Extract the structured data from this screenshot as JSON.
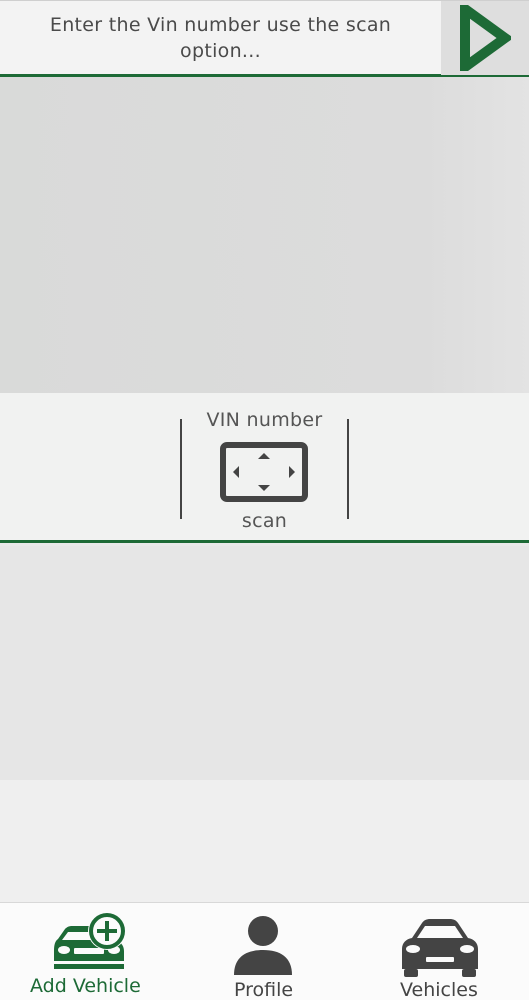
{
  "search": {
    "placeholder": "Enter the Vin number use the scan option..."
  },
  "scan": {
    "title": "VIN number",
    "label": "scan"
  },
  "nav": {
    "items": [
      {
        "label": "Add Vehicle",
        "icon": "car-add-icon",
        "active": true
      },
      {
        "label": "Profile",
        "icon": "person-icon",
        "active": false
      },
      {
        "label": "Vehicles",
        "icon": "car-icon",
        "active": false
      }
    ]
  },
  "colors": {
    "accent": "#1d6a36",
    "icon": "#444444"
  }
}
